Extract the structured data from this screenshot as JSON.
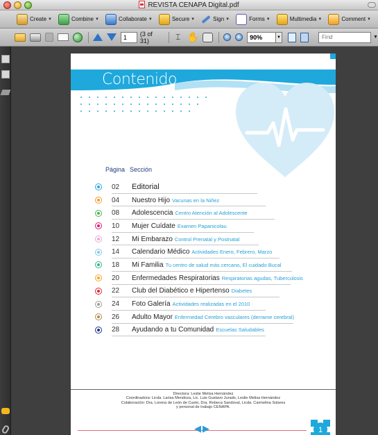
{
  "window": {
    "title": "REVISTA CENAPA Digital.pdf"
  },
  "task_toolbar": {
    "items": [
      {
        "label": "Create",
        "icon": "create-icon"
      },
      {
        "label": "Combine",
        "icon": "combine-icon"
      },
      {
        "label": "Collaborate",
        "icon": "collaborate-icon"
      },
      {
        "label": "Secure",
        "icon": "lock-icon"
      },
      {
        "label": "Sign",
        "icon": "pen-icon"
      },
      {
        "label": "Forms",
        "icon": "forms-icon"
      },
      {
        "label": "Multimedia",
        "icon": "multimedia-icon"
      },
      {
        "label": "Comment",
        "icon": "comment-icon"
      }
    ]
  },
  "nav_toolbar": {
    "page_number": "1",
    "page_of": "(3 of 31)",
    "zoom": "90%",
    "find_placeholder": "Find"
  },
  "document": {
    "heading": "Contenido",
    "column_page": "Página",
    "column_section": "Sección",
    "toc": [
      {
        "num": "02",
        "title": "Editorial",
        "sub": "",
        "color": "#27a7e0"
      },
      {
        "num": "04",
        "title": "Nuestro Hijo",
        "sub": "Vacunas en la Niñez",
        "color": "#f39a2b"
      },
      {
        "num": "08",
        "title": "Adolescencia",
        "sub": "Centro Atención al Adolescente",
        "color": "#4bb84f"
      },
      {
        "num": "10",
        "title": "Mujer Cuídate",
        "sub": "Examen Papanicolau",
        "color": "#e0177a"
      },
      {
        "num": "12",
        "title": "Mi Embarazo",
        "sub": "Control Prenatal y Postnatal",
        "color": "#e8a7d6"
      },
      {
        "num": "14",
        "title": "Calendario Médico",
        "sub": "Actividades Enero, Febrero, Marzo",
        "color": "#7ec9ec"
      },
      {
        "num": "18",
        "title": "Mi Familia",
        "sub": "Tu centro de salud más cercano, El cuidado Bucal",
        "color": "#2fb58d"
      },
      {
        "num": "20",
        "title": "Enfermedades Respiratorias",
        "sub": "Respiratorias agudas, Tuberculosis",
        "color": "#f6a623"
      },
      {
        "num": "22",
        "title": "Club del Diabético e Hipertenso",
        "sub": "Diabetes",
        "color": "#e1242c"
      },
      {
        "num": "24",
        "title": "Foto Galería",
        "sub": "Actividades realizadas en el 2010",
        "color": "#9c9c9c"
      },
      {
        "num": "26",
        "title": "Adulto Mayor",
        "sub": "Enfermedad Cerebro vasculares (derrame cerebral)",
        "color": "#b38a4a"
      },
      {
        "num": "28",
        "title": "Ayudando a tu Comunidad",
        "sub": "Escuelas Saludables",
        "color": "#1c2f8a"
      }
    ],
    "credits": [
      "Directora: Leslie Melisa Hernández",
      "Coordinadora: Licda. Larisa Mendoza, Lic. Luis Gustavo Jurado, Leslie Melisa Hernández",
      "Colaboración: Dra. Lorena de León de Cueto, Dra. Rebeca Sandoval, Licda. Carmelina Solares",
      "y personal de trabajo CENAPA."
    ],
    "page_badge": "1"
  },
  "colors": {
    "accent_blue": "#1fa8dc",
    "heart_blue": "#d4ecf8",
    "footer_pink": "#e36b80"
  }
}
